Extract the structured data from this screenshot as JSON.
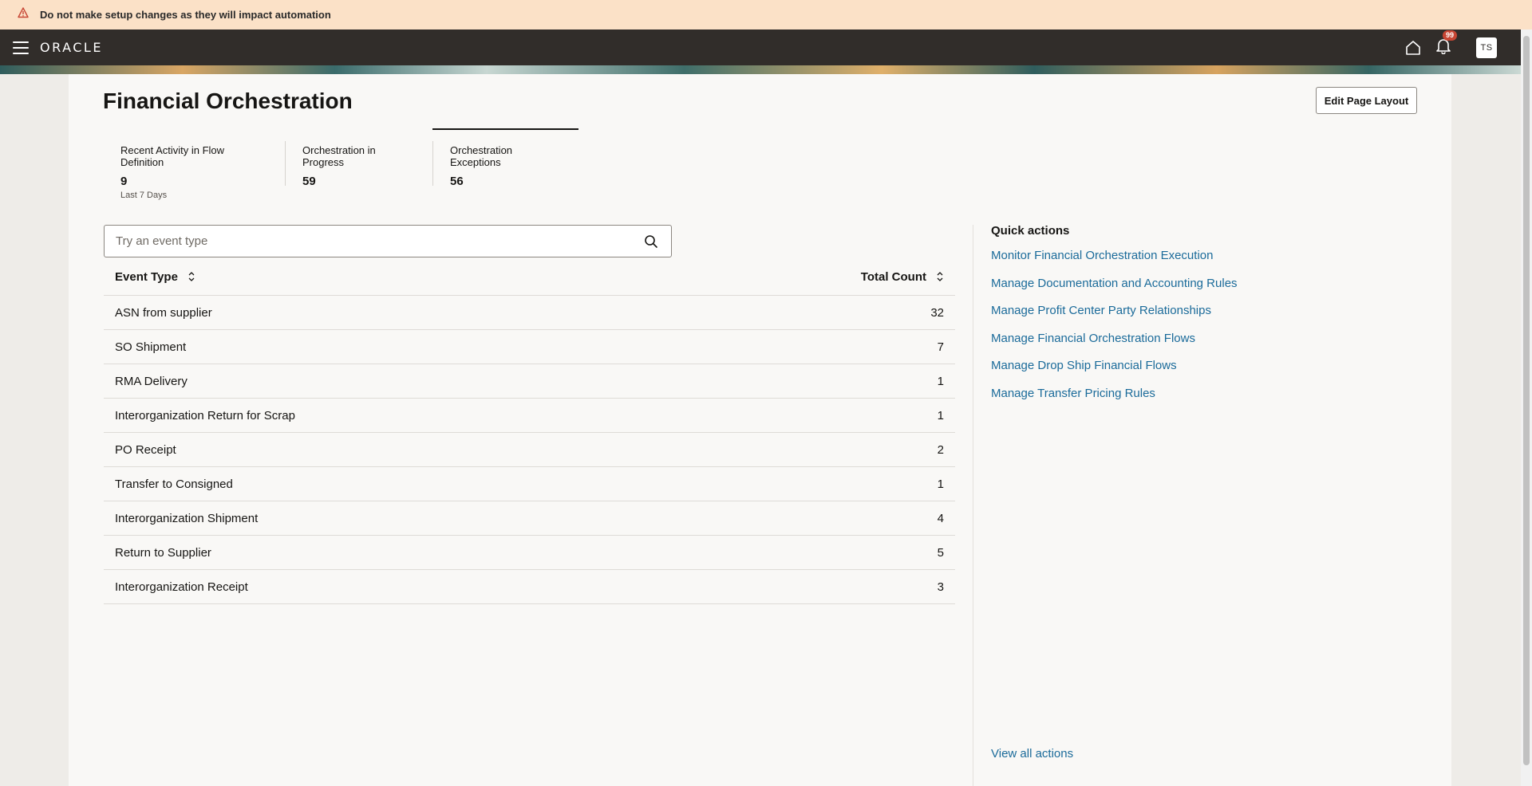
{
  "warning": {
    "text": "Do not make setup changes as they will impact automation"
  },
  "header": {
    "logo": "ORACLE",
    "notifications_count": "99",
    "user_initials": "TS",
    "icons": [
      "hamburger-menu-icon",
      "home-icon",
      "bell-icon"
    ]
  },
  "page": {
    "title": "Financial Orchestration",
    "edit_layout_label": "Edit Page Layout"
  },
  "metrics": [
    {
      "label": "Recent Activity in Flow Definition",
      "value": "9",
      "sub": "Last 7 Days"
    },
    {
      "label": "Orchestration in Progress",
      "value": "59"
    },
    {
      "label": "Orchestration Exceptions",
      "value": "56",
      "active": true
    }
  ],
  "search": {
    "placeholder": "Try an event type",
    "value": ""
  },
  "table": {
    "headers": {
      "event_type": "Event Type",
      "total_count": "Total Count"
    },
    "rows": [
      {
        "event_type": "ASN from supplier",
        "count": "32"
      },
      {
        "event_type": "SO Shipment",
        "count": "7"
      },
      {
        "event_type": "RMA Delivery",
        "count": "1"
      },
      {
        "event_type": "Interorganization Return for Scrap",
        "count": "1"
      },
      {
        "event_type": "PO Receipt",
        "count": "2"
      },
      {
        "event_type": "Transfer to Consigned",
        "count": "1"
      },
      {
        "event_type": "Interorganization Shipment",
        "count": "4"
      },
      {
        "event_type": "Return to Supplier",
        "count": "5"
      },
      {
        "event_type": "Interorganization Receipt",
        "count": "3"
      }
    ]
  },
  "quick_actions": {
    "title": "Quick actions",
    "links": [
      "Monitor Financial Orchestration Execution",
      "Manage Documentation and Accounting Rules",
      "Manage Profit Center Party Relationships",
      "Manage Financial Orchestration Flows",
      "Manage Drop Ship Financial Flows",
      "Manage Transfer Pricing Rules"
    ],
    "view_all": "View all actions"
  },
  "colors": {
    "warning_bg": "#fbe1c7",
    "header_bg": "#312d2a",
    "link": "#1b6b9a",
    "badge": "#c74634"
  }
}
